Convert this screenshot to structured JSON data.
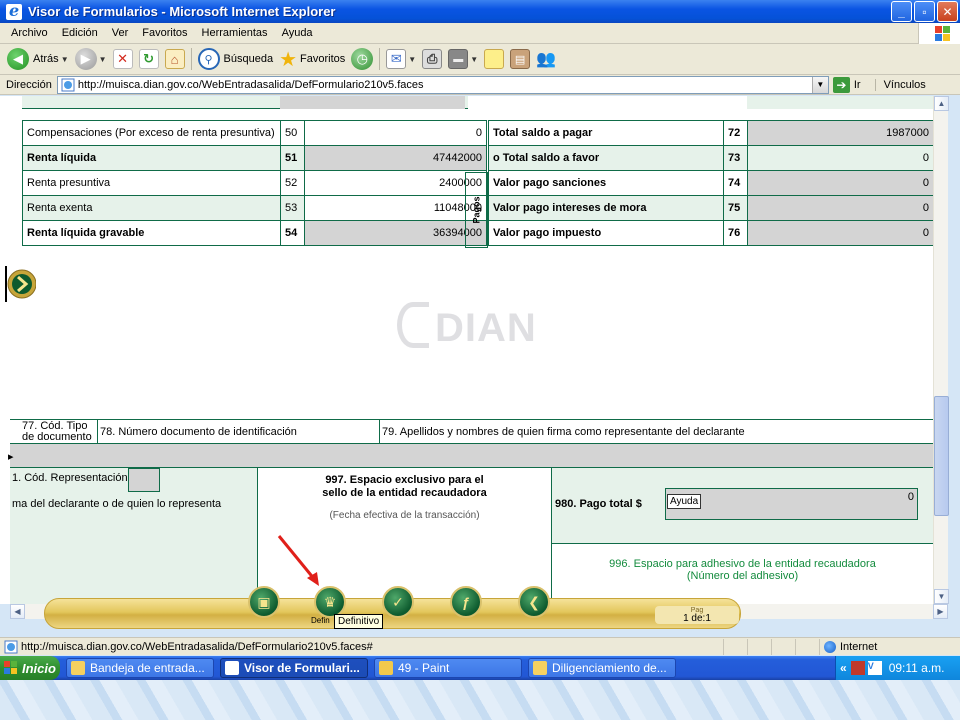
{
  "window": {
    "title": "Visor de Formularios - Microsoft Internet Explorer",
    "min": "_",
    "max": "▫",
    "close": "✕"
  },
  "menu": [
    "Archivo",
    "Edición",
    "Ver",
    "Favoritos",
    "Herramientas",
    "Ayuda"
  ],
  "toolbar": {
    "back": "Atrás",
    "search": "Búsqueda",
    "favorites": "Favoritos"
  },
  "address": {
    "label": "Dirección",
    "url": "http://muisca.dian.gov.co/WebEntradasalida/DefFormulario210v5.faces",
    "go": "Ir",
    "links": "Vínculos"
  },
  "form": {
    "left_rows": [
      {
        "label": "Compensaciones (Por exceso de renta presuntiva)",
        "num": "50",
        "value": "0",
        "bold": false,
        "shade": false,
        "grey": false
      },
      {
        "label": "Renta líquida",
        "num": "51",
        "value": "47442000",
        "bold": true,
        "shade": true,
        "grey": true
      },
      {
        "label": "Renta presuntiva",
        "num": "52",
        "value": "2400000",
        "bold": false,
        "shade": false,
        "grey": false
      },
      {
        "label": "Renta exenta",
        "num": "53",
        "value": "11048000",
        "bold": false,
        "shade": true,
        "grey": false
      },
      {
        "label": "Renta líquida gravable",
        "num": "54",
        "value": "36394000",
        "bold": true,
        "shade": false,
        "grey": true
      }
    ],
    "right_rows": [
      {
        "label": "Total saldo a pagar",
        "num": "72",
        "value": "1987000",
        "shade": false
      },
      {
        "label": "o Total saldo a favor",
        "num": "73",
        "value": "0",
        "shade": true
      },
      {
        "label": "Valor pago sanciones",
        "num": "74",
        "value": "0",
        "shade": false
      },
      {
        "label": "Valor pago intereses de mora",
        "num": "75",
        "value": "0",
        "shade": true
      },
      {
        "label": "Valor pago impuesto",
        "num": "76",
        "value": "0",
        "shade": false
      }
    ],
    "pagos_label": "Pagos",
    "logo_word": "DIAN",
    "sig_head": {
      "c77": "77. Cód. Tipo de documento",
      "c78": "78. Número documento de identificación",
      "c79": "79. Apellidos y nombres de quien firma como representante del declarante"
    },
    "c81": "1. Cód. Representación",
    "firma": "ma del declarante o de quien lo representa",
    "c997_title": "997. Espacio exclusivo para el sello de la entidad recaudadora",
    "c997_sub": "(Fecha efectiva de la transacción)",
    "c980_label": "980.  Pago total $",
    "c980_value": "0",
    "ayuda": "Ayuda",
    "c996_title": "996. Espacio para adhesivo de la entidad recaudadora",
    "c996_sub": "(Número del adhesivo)"
  },
  "nav": {
    "partial_label": "Defin",
    "tooltip": "Definitivo",
    "page_label": "Pag",
    "page_value": "1 de:1"
  },
  "status": {
    "url": "http://muisca.dian.gov.co/WebEntradasalida/DefFormulario210v5.faces#",
    "zone": "Internet"
  },
  "taskbar": {
    "start": "Inicio",
    "tasks": [
      {
        "label": "Bandeja de entrada...",
        "active": false
      },
      {
        "label": "Visor de Formulari...",
        "active": true
      },
      {
        "label": "49 - Paint",
        "active": false
      },
      {
        "label": "Diligenciamiento de...",
        "active": false
      }
    ],
    "time": "09:11 a.m."
  }
}
